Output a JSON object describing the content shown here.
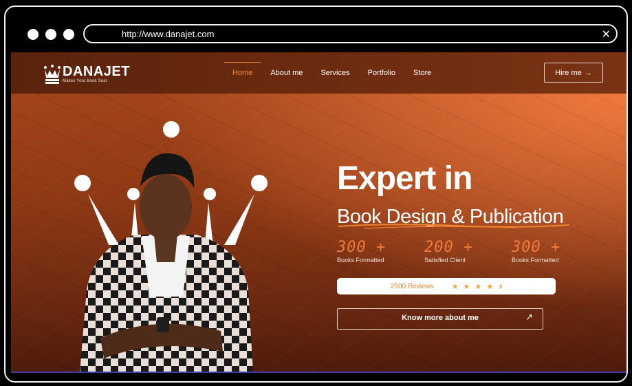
{
  "browser": {
    "url": "http://www.danajet.com",
    "close_glyph": "✕"
  },
  "brand": {
    "name": "DANAJET",
    "tagline": "Makes Your Book Soar"
  },
  "nav": {
    "items": [
      {
        "label": "Home",
        "active": true
      },
      {
        "label": "About me",
        "active": false
      },
      {
        "label": "Services",
        "active": false
      },
      {
        "label": "Portfolio",
        "active": false
      },
      {
        "label": "Store",
        "active": false
      }
    ],
    "cta_label": "Hire me",
    "cta_arrow": "→"
  },
  "hero": {
    "headline": "Expert in",
    "subheadline": "Book Design & Publication",
    "stats": [
      {
        "value": "300 +",
        "label": "Books Formatted"
      },
      {
        "value": "200 +",
        "label": "Satisfied Client"
      },
      {
        "value": "300 +",
        "label": "Books Formatted"
      }
    ],
    "reviews": {
      "text": "2500 Reviews",
      "rating": 4.5,
      "stars": [
        "★",
        "★",
        "★",
        "★",
        "⯨"
      ]
    },
    "button_label": "Know more about me",
    "button_arrow": "↗"
  },
  "colors": {
    "accent": "#f27a3a",
    "star": "#f2a23c",
    "background_dark": "#5a230c",
    "background_light": "#f07a3f"
  },
  "icons": [
    "crown-icon",
    "arrow-right-icon",
    "arrow-up-right-icon",
    "star-icon",
    "close-icon"
  ]
}
